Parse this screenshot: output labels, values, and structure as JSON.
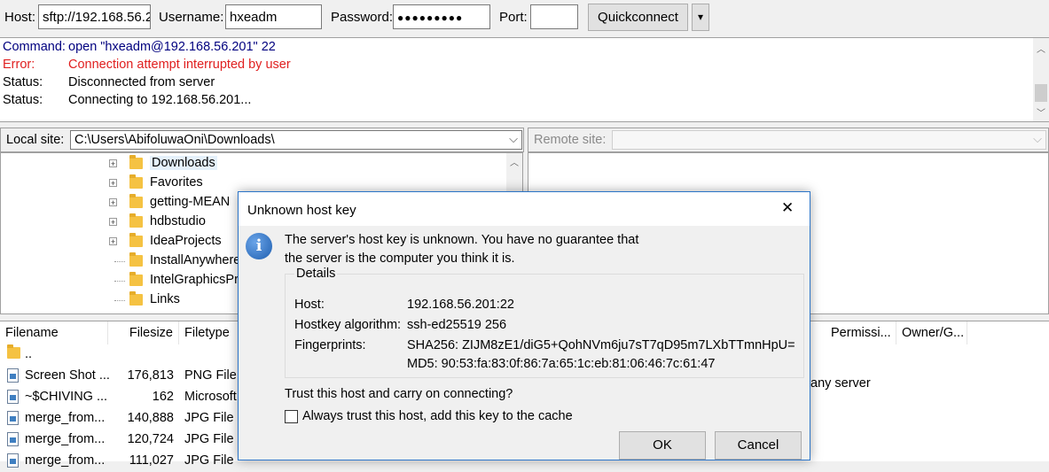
{
  "toolbar": {
    "host_label": "Host:",
    "host_value": "sftp://192.168.56.2",
    "username_label": "Username:",
    "username_value": "hxeadm",
    "password_label": "Password:",
    "password_value": "●●●●●●●●●",
    "port_label": "Port:",
    "port_value": "",
    "quickconnect_label": "Quickconnect",
    "dropdown_glyph": "▾"
  },
  "log": [
    {
      "key": "Command:",
      "text": "open \"hxeadm@192.168.56.201\" 22",
      "color": "#00007f"
    },
    {
      "key": "Error:",
      "text": "Connection attempt interrupted by user",
      "color": "#e02020"
    },
    {
      "key": "Status:",
      "text": "Disconnected from server",
      "color": "#000000"
    },
    {
      "key": "Status:",
      "text": "Connecting to 192.168.56.201...",
      "color": "#000000"
    }
  ],
  "local_site": {
    "label": "Local site:",
    "path": "C:\\Users\\AbifoluwaOni\\Downloads\\"
  },
  "remote_site": {
    "label": "Remote site:"
  },
  "tree": [
    {
      "name": "Downloads",
      "expand": "+",
      "icon": "download-folder-icon"
    },
    {
      "name": "Favorites",
      "expand": "+",
      "icon": "favorites-folder-icon"
    },
    {
      "name": "getting-MEAN",
      "expand": "+",
      "icon": "folder-icon"
    },
    {
      "name": "hdbstudio",
      "expand": "+",
      "icon": "folder-icon"
    },
    {
      "name": "IdeaProjects",
      "expand": "+",
      "icon": "folder-icon"
    },
    {
      "name": "InstallAnywhere",
      "expand": "",
      "icon": "folder-icon"
    },
    {
      "name": "IntelGraphicsPr",
      "expand": "",
      "icon": "folder-icon"
    },
    {
      "name": "Links",
      "expand": "",
      "icon": "links-folder-icon"
    }
  ],
  "local_columns": [
    "Filename",
    "Filesize",
    "Filetype"
  ],
  "remote_columns": [
    "Permissi...",
    "Owner/G..."
  ],
  "files": [
    {
      "name": "..",
      "size": "",
      "type": ""
    },
    {
      "name": "Screen Shot ...",
      "size": "176,813",
      "type": "PNG File"
    },
    {
      "name": "~$CHIVING ...",
      "size": "162",
      "type": "Microsoft"
    },
    {
      "name": "merge_from...",
      "size": "140,888",
      "type": "JPG File"
    },
    {
      "name": "merge_from...",
      "size": "120,724",
      "type": "JPG File"
    },
    {
      "name": "merge_from...",
      "size": "111,027",
      "type": "JPG File"
    }
  ],
  "remote_status": "any server",
  "dialog": {
    "title": "Unknown host key",
    "message_line1": "The server's host key is unknown. You have no guarantee that",
    "message_line2": "the server is the computer you think it is.",
    "details_label": "Details",
    "host_key": "Host:",
    "host_val": "192.168.56.201:22",
    "algo_key": "Hostkey algorithm:",
    "algo_val": "ssh-ed25519 256",
    "fp_key": "Fingerprints:",
    "fp_val1": "SHA256: ZIJM8zE1/diG5+QohNVm6ju7sT7qD95m7LXbTTmnHpU=",
    "fp_val2": "MD5: 90:53:fa:83:0f:86:7a:65:1c:eb:81:06:46:7c:61:47",
    "trust_question": "Trust this host and carry on connecting?",
    "always_trust_label": "Always trust this host, add this key to the cache",
    "always_trust_checked": false,
    "ok_label": "OK",
    "cancel_label": "Cancel",
    "close_glyph": "✕",
    "info_glyph": "i"
  },
  "colors": {
    "accent": "#2b74c8",
    "error": "#e02020",
    "command": "#00007f"
  }
}
